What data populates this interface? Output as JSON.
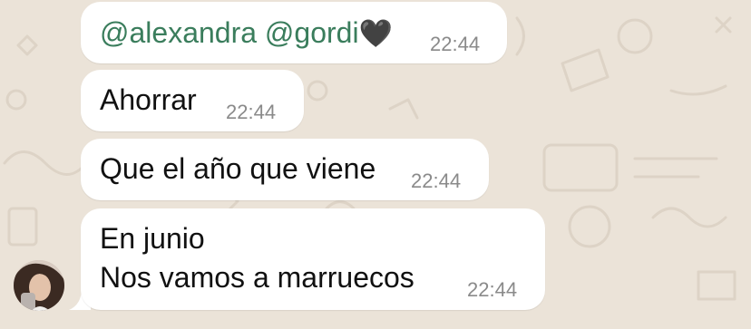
{
  "theme": {
    "background": "#ebe3d8",
    "bubble": "#ffffff",
    "mention_color": "#3a7d5c",
    "time_color": "#8a8a8a"
  },
  "messages": [
    {
      "mention_1": "@alexandra",
      "mention_2": "@gordi",
      "emoji": "🖤",
      "time": "22:44"
    },
    {
      "text": "Ahorrar",
      "time": "22:44"
    },
    {
      "text": "Que el año que viene",
      "time": "22:44"
    },
    {
      "line_1": "En junio",
      "line_2": "Nos vamos a marruecos",
      "time": "22:44"
    }
  ],
  "sender": {
    "avatar_icon": "profile-photo"
  }
}
